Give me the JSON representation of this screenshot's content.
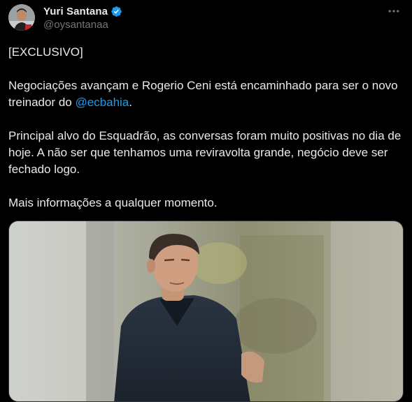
{
  "author": {
    "display_name": "Yuri Santana",
    "handle": "@oysantanaa",
    "verified": true,
    "verified_color": "#1d9bf0"
  },
  "tweet": {
    "line1": "[EXCLUSIVO]",
    "line2_before": "Negociações avançam e Rogerio Ceni está encaminhado para ser o novo treinador do ",
    "line2_mention": "@ecbahia",
    "line2_after": ".",
    "line3": "Principal alvo do Esquadrão, as conversas foram muito positivas no dia de hoje. A não ser que tenhamos uma reviravolta grande, negócio deve ser fechado logo.",
    "line4": "Mais informações a qualquer momento."
  },
  "icons": {
    "more": "more-horizontal-icon",
    "verified": "verified-badge-icon"
  },
  "colors": {
    "background": "#000000",
    "text": "#e7e9ea",
    "secondary_text": "#71767b",
    "link": "#1d9bf0"
  }
}
